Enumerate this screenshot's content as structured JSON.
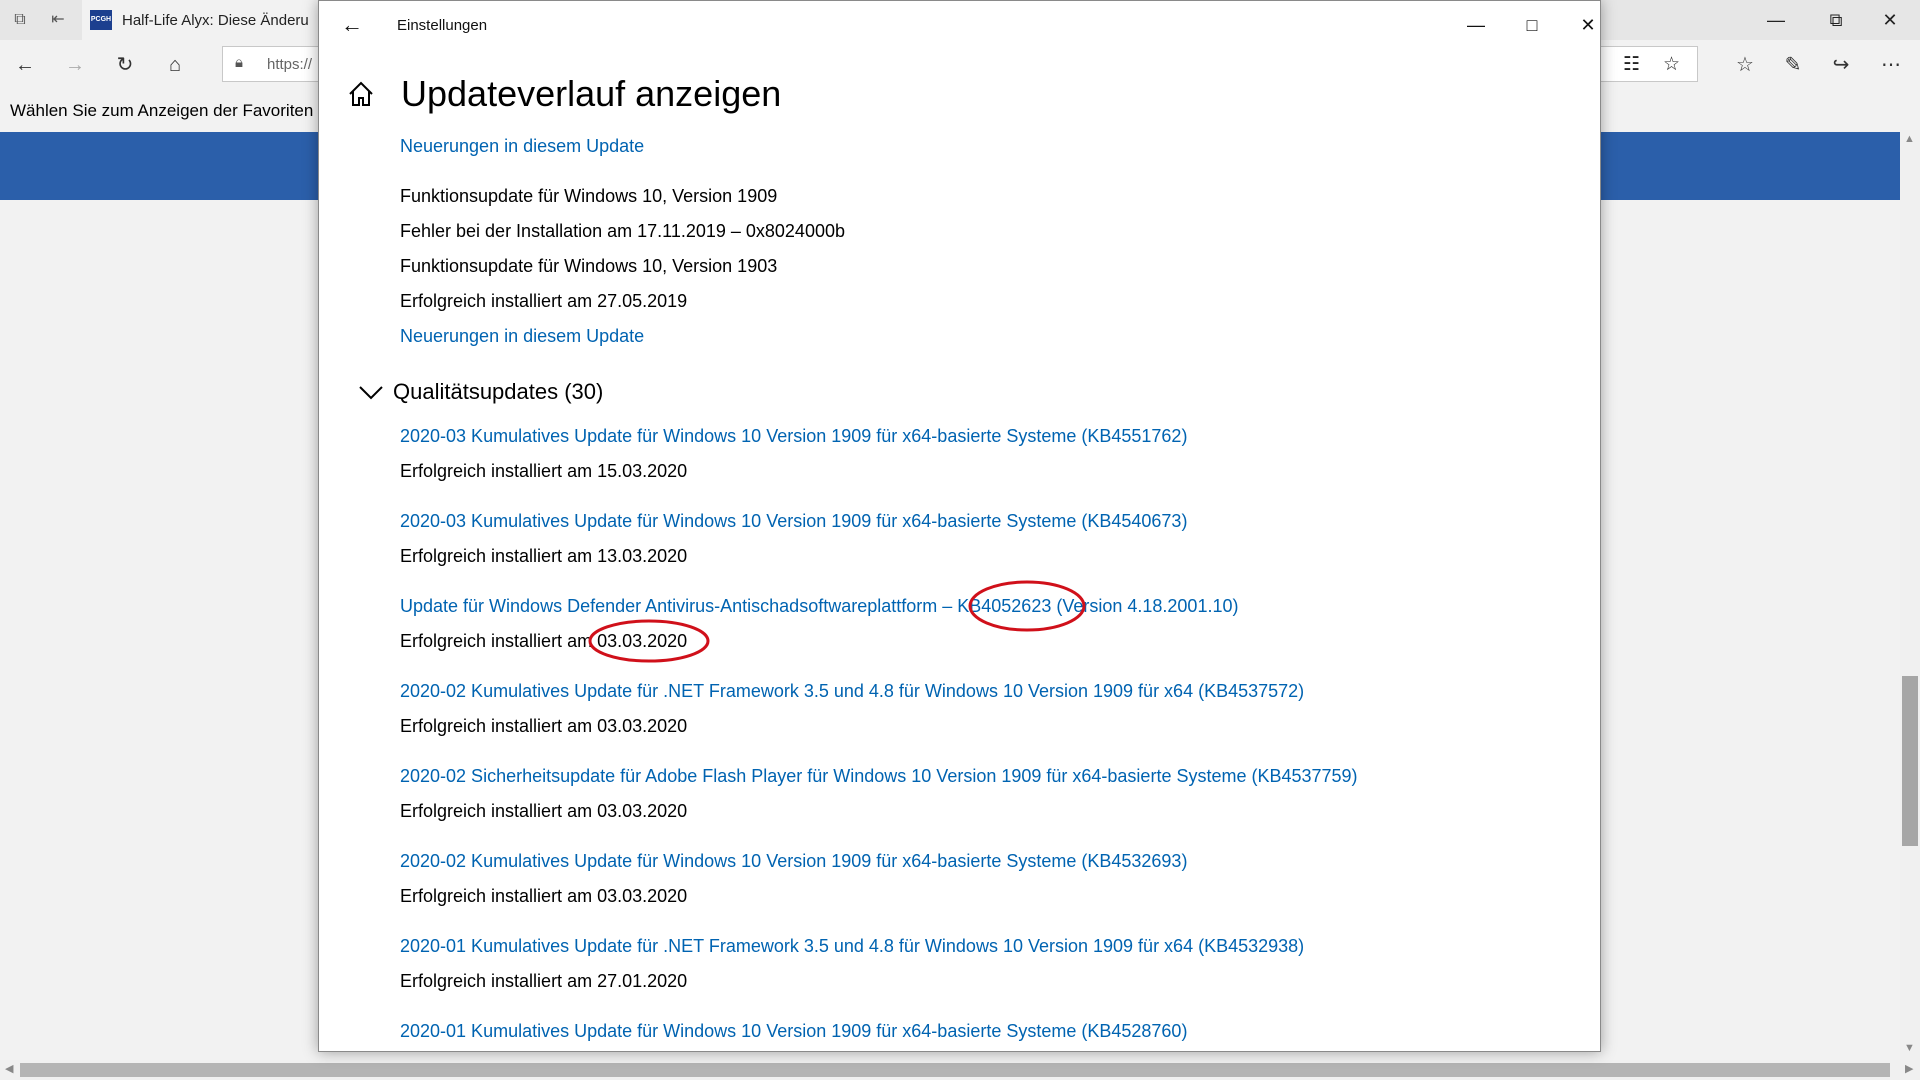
{
  "browser": {
    "tab_title": "Half-Life Alyx: Diese Änderu",
    "favicon_text": "PCGH",
    "address_text": "https://",
    "favorites_message": "Wählen Sie zum Anzeigen der Favoriten",
    "accent_color": "#2b5faa"
  },
  "settings": {
    "window_title": "Einstellungen",
    "page_title": "Updateverlauf anzeigen",
    "link_color": "#0063b1",
    "feature_entries": [
      {
        "text": "Neuerungen in diesem Update",
        "kind": "link"
      },
      {
        "text": "Funktionsupdate für Windows 10, Version 1909",
        "kind": "text"
      },
      {
        "text": "Fehler bei der Installation am 17.11.2019 – 0x8024000b",
        "kind": "text"
      },
      {
        "text": "Funktionsupdate für Windows 10, Version 1903",
        "kind": "text"
      },
      {
        "text": "Erfolgreich installiert am 27.05.2019",
        "kind": "text"
      },
      {
        "text": "Neuerungen in diesem Update",
        "kind": "link"
      }
    ],
    "quality_section_title": "Qualitätsupdates (30)",
    "quality_updates": [
      {
        "title": "2020-03 Kumulatives Update für Windows 10 Version 1909 für x64-basierte Systeme (KB4551762)",
        "status": "Erfolgreich installiert am 15.03.2020"
      },
      {
        "title": "2020-03 Kumulatives Update für Windows 10 Version 1909 für x64-basierte Systeme (KB4540673)",
        "status": "Erfolgreich installiert am 13.03.2020"
      },
      {
        "title": "Update für Windows Defender Antivirus-Antischadsoftwareplattform – KB4052623 (Version 4.18.2001.10)",
        "status": "Erfolgreich installiert am 03.03.2020"
      },
      {
        "title": "2020-02 Kumulatives Update für .NET Framework 3.5 und 4.8 für Windows 10 Version 1909 für x64 (KB4537572)",
        "status": "Erfolgreich installiert am 03.03.2020"
      },
      {
        "title": "2020-02 Sicherheitsupdate für Adobe Flash Player für Windows 10 Version 1909 für x64-basierte Systeme (KB4537759)",
        "status": "Erfolgreich installiert am 03.03.2020"
      },
      {
        "title": "2020-02 Kumulatives Update für Windows 10 Version 1909 für x64-basierte Systeme (KB4532693)",
        "status": "Erfolgreich installiert am 03.03.2020"
      },
      {
        "title": "2020-01 Kumulatives Update für .NET Framework 3.5 und 4.8 für Windows 10 Version 1909 für x64 (KB4532938)",
        "status": "Erfolgreich installiert am 27.01.2020"
      },
      {
        "title": "2020-01 Kumulatives Update für Windows 10 Version 1909 für x64-basierte Systeme (KB4528760)",
        "status": ""
      }
    ],
    "annotation_color": "#d0101a"
  }
}
